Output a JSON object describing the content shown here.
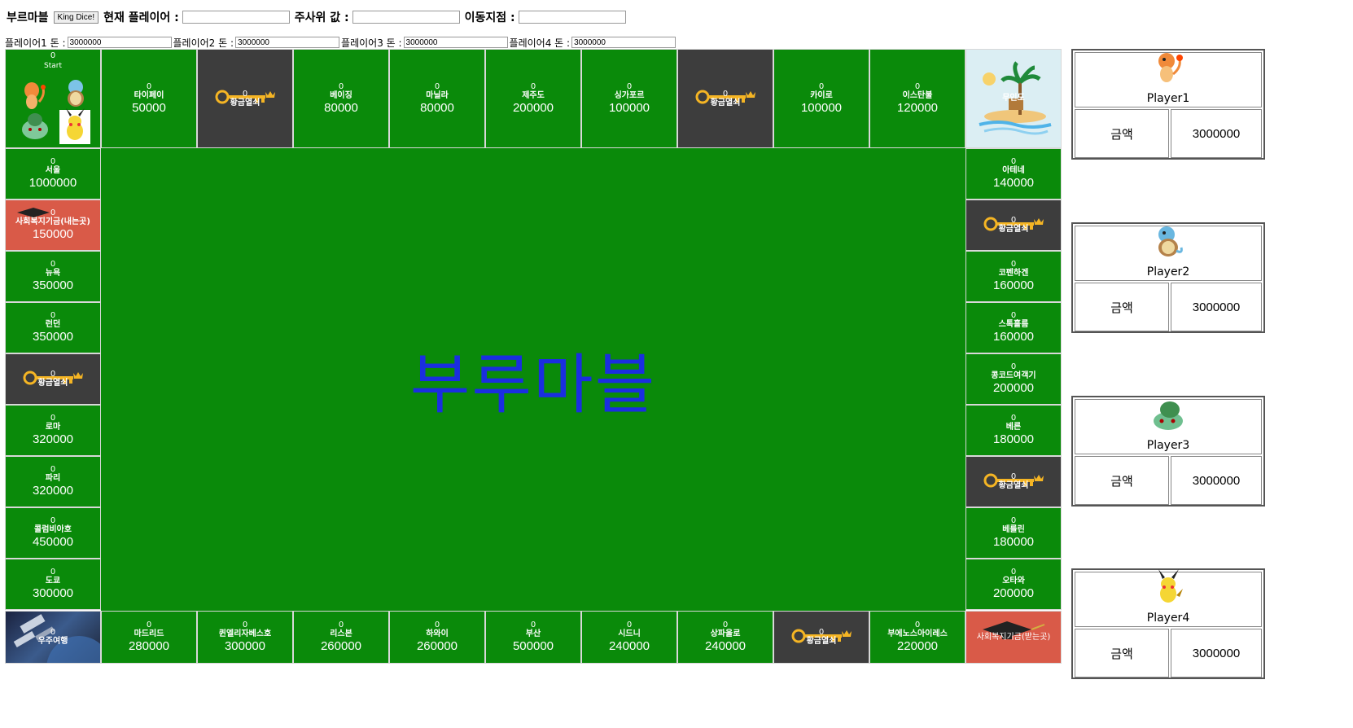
{
  "header": {
    "game_title": "부르마블",
    "dice_button": "King Dice!",
    "current_player_label": "현재 플레이어 :",
    "current_player_value": "",
    "dice_value_label": "주사위 값 :",
    "dice_value": "",
    "move_label": "이동지점 :",
    "move_value": ""
  },
  "money": [
    {
      "label": "플레이어1 돈 :",
      "value": "3000000"
    },
    {
      "label": "플레이어2 돈 :",
      "value": "3000000"
    },
    {
      "label": "플레이어3 돈 :",
      "value": "3000000"
    },
    {
      "label": "플레이어4 돈 :",
      "value": "3000000"
    }
  ],
  "board": {
    "title": "부루마블",
    "start": {
      "owner": "0",
      "name": "Start"
    },
    "island": {
      "name": "무인도"
    },
    "space": {
      "owner": "0",
      "name": "우주여행"
    },
    "welfare_give": {
      "owner": "0",
      "name": "사회복지기금(내는곳)",
      "price": "150000"
    },
    "welfare_take": {
      "name": "사회복지기금(받는곳)"
    },
    "top": [
      {
        "owner": "0",
        "name": "타이페이",
        "price": "50000"
      },
      {
        "owner": "0",
        "name": "황금열쇠",
        "key": true
      },
      {
        "owner": "0",
        "name": "베이징",
        "price": "80000"
      },
      {
        "owner": "0",
        "name": "마닐라",
        "price": "80000"
      },
      {
        "owner": "0",
        "name": "제주도",
        "price": "200000"
      },
      {
        "owner": "0",
        "name": "싱가포르",
        "price": "100000"
      },
      {
        "owner": "0",
        "name": "황금열쇠",
        "key": true
      },
      {
        "owner": "0",
        "name": "카이로",
        "price": "100000"
      },
      {
        "owner": "0",
        "name": "이스탄불",
        "price": "120000"
      }
    ],
    "left": [
      {
        "owner": "0",
        "name": "서울",
        "price": "1000000"
      },
      {
        "owner": "0",
        "name": "사회복지기금(내는곳)",
        "price": "150000",
        "welfare": true
      },
      {
        "owner": "0",
        "name": "뉴욕",
        "price": "350000"
      },
      {
        "owner": "0",
        "name": "런던",
        "price": "350000"
      },
      {
        "owner": "0",
        "name": "황금열쇠",
        "key": true
      },
      {
        "owner": "0",
        "name": "로마",
        "price": "320000"
      },
      {
        "owner": "0",
        "name": "파리",
        "price": "320000"
      },
      {
        "owner": "0",
        "name": "콜럼비아호",
        "price": "450000"
      },
      {
        "owner": "0",
        "name": "도쿄",
        "price": "300000"
      }
    ],
    "right": [
      {
        "owner": "0",
        "name": "아테네",
        "price": "140000"
      },
      {
        "owner": "0",
        "name": "황금열쇠",
        "key": true
      },
      {
        "owner": "0",
        "name": "코펜하겐",
        "price": "160000"
      },
      {
        "owner": "0",
        "name": "스톡홀름",
        "price": "160000"
      },
      {
        "owner": "0",
        "name": "콩코드여객기",
        "price": "200000"
      },
      {
        "owner": "0",
        "name": "베른",
        "price": "180000"
      },
      {
        "owner": "0",
        "name": "황금열쇠",
        "key": true
      },
      {
        "owner": "0",
        "name": "베를린",
        "price": "180000"
      },
      {
        "owner": "0",
        "name": "오타와",
        "price": "200000"
      }
    ],
    "bottom": [
      {
        "owner": "0",
        "name": "마드리드",
        "price": "280000"
      },
      {
        "owner": "0",
        "name": "퀸엘리자베스호",
        "price": "300000"
      },
      {
        "owner": "0",
        "name": "리스본",
        "price": "260000"
      },
      {
        "owner": "0",
        "name": "하와이",
        "price": "260000"
      },
      {
        "owner": "0",
        "name": "부산",
        "price": "500000"
      },
      {
        "owner": "0",
        "name": "시드니",
        "price": "240000"
      },
      {
        "owner": "0",
        "name": "상파울로",
        "price": "240000"
      },
      {
        "owner": "0",
        "name": "황금열쇠",
        "key": true
      },
      {
        "owner": "0",
        "name": "부에노스아이레스",
        "price": "220000"
      }
    ]
  },
  "players": [
    {
      "name": "Player1",
      "money_label": "금액",
      "money": "3000000",
      "icon": "charmander-icon",
      "color": "#f08a3a"
    },
    {
      "name": "Player2",
      "money_label": "금액",
      "money": "3000000",
      "icon": "squirtle-icon",
      "color": "#6ab7e0"
    },
    {
      "name": "Player3",
      "money_label": "금액",
      "money": "3000000",
      "icon": "bulbasaur-icon",
      "color": "#6fbf8f"
    },
    {
      "name": "Player4",
      "money_label": "금액",
      "money": "3000000",
      "icon": "pikachu-icon",
      "color": "#f5d634"
    }
  ],
  "colors": {
    "board_green": "#0a8a0a",
    "key_bg": "#3d3d3d",
    "welfare_bg": "#d95a48",
    "title_blue": "#1a2ee0"
  }
}
